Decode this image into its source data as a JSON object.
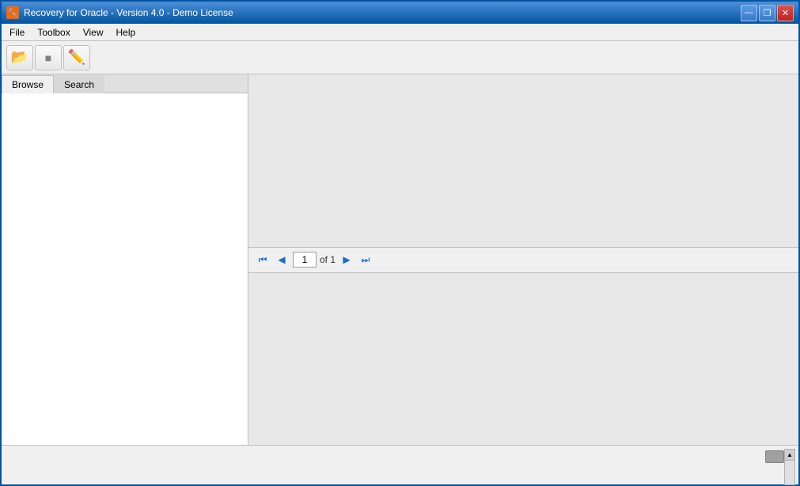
{
  "window": {
    "title": "Recovery for Oracle - Version 4.0 - Demo License",
    "icon": "🔧"
  },
  "titleControls": {
    "minimize": "—",
    "restore": "❐",
    "close": "✕"
  },
  "menuBar": {
    "items": [
      "File",
      "Toolbox",
      "View",
      "Help"
    ]
  },
  "toolbar": {
    "buttons": [
      {
        "name": "open-folder",
        "icon": "📂"
      },
      {
        "name": "stop",
        "icon": "⬛"
      },
      {
        "name": "edit",
        "icon": "✏️"
      }
    ]
  },
  "tabs": {
    "browse": "Browse",
    "search": "Search"
  },
  "pagination": {
    "page": "1",
    "of_label": "of 1"
  }
}
